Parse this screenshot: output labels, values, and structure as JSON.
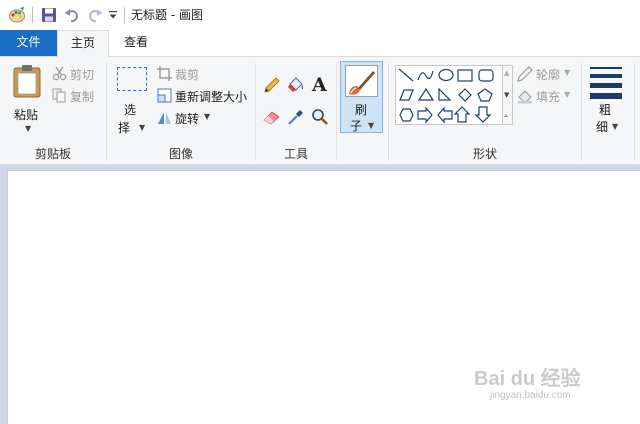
{
  "window": {
    "title": "无标题 - 画图"
  },
  "quick_access": {
    "icons": [
      "paint-app-icon",
      "save-icon",
      "undo-icon",
      "redo-icon",
      "customize-dropdown-icon"
    ]
  },
  "tabs": [
    {
      "label": "文件"
    },
    {
      "label": "主页"
    },
    {
      "label": "查看"
    }
  ],
  "ribbon": {
    "clipboard": {
      "label": "剪贴板",
      "paste": "粘贴",
      "cut": "剪切",
      "copy": "复制"
    },
    "image": {
      "label": "图像",
      "select_1": "选",
      "select_2": "择",
      "crop": "裁剪",
      "resize": "重新调整大小",
      "rotate": "旋转"
    },
    "tools": {
      "label": "工具",
      "icons": [
        "pencil-icon",
        "fill-bucket-icon",
        "text-icon",
        "eraser-icon",
        "color-picker-icon",
        "magnifier-icon"
      ]
    },
    "brush": {
      "label_1": "刷",
      "label_2": "子"
    },
    "shapes": {
      "label": "形状",
      "outline": "轮廓",
      "fill": "填充"
    },
    "size": {
      "label_1": "粗",
      "label_2": "细"
    }
  },
  "colors": {
    "accent": "#1a6dc5",
    "ribbon_bg": "#f5f6f7",
    "canvas_bg": "#ffffff",
    "workspace_bg": "#cfd9e6"
  },
  "watermark": {
    "brand": "Bai du 经验",
    "url": "jingyan.baidu.com"
  }
}
